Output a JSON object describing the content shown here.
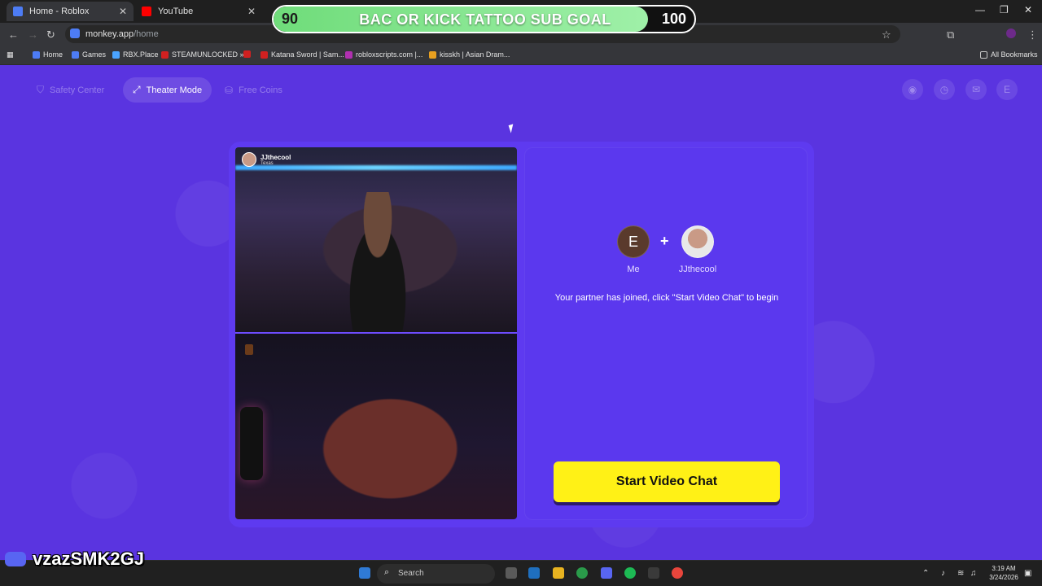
{
  "browser": {
    "tabs": [
      {
        "title": "Home - Roblox",
        "close": "✕"
      },
      {
        "title": "YouTube",
        "close": "✕"
      }
    ],
    "window_controls": {
      "minimize": "—",
      "restore": "❐",
      "close": "✕"
    },
    "url": {
      "host": "monkey.app",
      "path": "/home"
    },
    "bookmarks": [
      {
        "label": "Home",
        "color": "#4d7cf5"
      },
      {
        "label": "Games",
        "color": "#4d7cf5"
      },
      {
        "label": "RBX.Place",
        "color": "#4aa3ff"
      },
      {
        "label": "STEAMUNLOCKED »...",
        "color": "#d02020"
      },
      {
        "label": "Katana Sword | Sam...",
        "color": "#d02020"
      },
      {
        "label": "robloxscripts.com |...",
        "color": "#b030b0"
      },
      {
        "label": "kisskh | Asian Dram...",
        "color": "#e8a020"
      }
    ],
    "all_bookmarks_label": "All Bookmarks"
  },
  "overlay_goal": {
    "title": "BAC OR KICK TATTOO SUB GOAL",
    "start": "90",
    "end": "100",
    "progress_fraction": 0.89,
    "fill_color": "#7fe08a"
  },
  "site_nav": {
    "items": [
      {
        "label": "Safety Center",
        "icon": "shield-icon",
        "active": false
      },
      {
        "label": "Theater Mode",
        "icon": "expand-icon",
        "active": true
      },
      {
        "label": "Free Coins",
        "icon": "coins-icon",
        "active": false
      }
    ],
    "profile_initial": "E"
  },
  "video_chat": {
    "partner": {
      "name": "JJthecool",
      "location": "Texas"
    },
    "me": {
      "label": "Me",
      "initial": "E"
    },
    "plus": "+",
    "join_message": "Your partner has joined, click \"Start Video Chat\" to begin",
    "start_button": "Start Video Chat",
    "accent_color": "#fff116",
    "page_color": "#5a34e0"
  },
  "taskbar": {
    "search_placeholder": "Search",
    "time": "3:19 AM",
    "date": "3/24/2026"
  },
  "stream_overlay": {
    "discord_user": "vzazSMK2GJ"
  }
}
